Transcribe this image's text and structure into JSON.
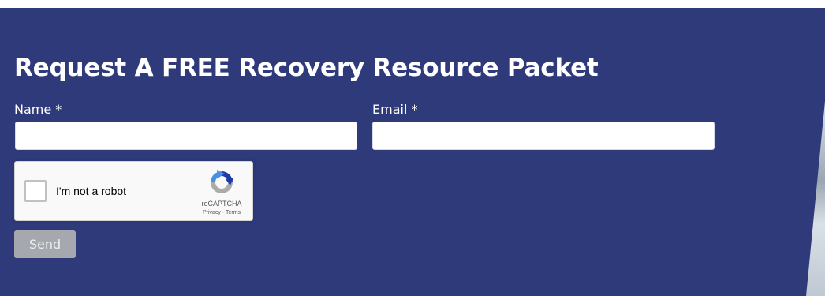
{
  "form": {
    "title": "Request A FREE Recovery Resource Packet",
    "name_label": "Name *",
    "name_value": "",
    "email_label": "Email *",
    "email_value": "",
    "send_label": "Send"
  },
  "recaptcha": {
    "checkbox_label": "I'm not a robot",
    "brand": "reCAPTCHA",
    "privacy_link": "Privacy",
    "separator": " - ",
    "terms_link": "Terms",
    "checked": false
  },
  "colors": {
    "panel_background": "#2e3a7a",
    "send_button_background": "#a6a8af",
    "recaptcha_logo_blue": "#1c3aa9",
    "recaptcha_logo_light_blue": "#4a90e2",
    "recaptcha_logo_gray": "#ababab"
  },
  "icons": {
    "recaptcha_logo": "recaptcha-logo-icon"
  }
}
